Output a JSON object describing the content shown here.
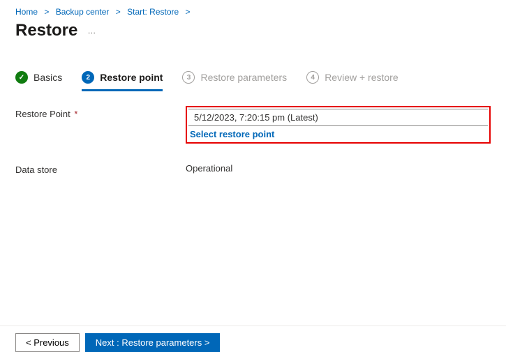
{
  "breadcrumb": {
    "items": [
      "Home",
      "Backup center",
      "Start: Restore"
    ]
  },
  "page": {
    "title": "Restore",
    "more": "…"
  },
  "tabs": {
    "basics": {
      "label": "Basics",
      "icon_check": "✓"
    },
    "restore_point": {
      "label": "Restore point",
      "num": "2"
    },
    "restore_params": {
      "label": "Restore parameters",
      "num": "3"
    },
    "review": {
      "label": "Review + restore",
      "num": "4"
    }
  },
  "form": {
    "restore_point": {
      "label": "Restore Point",
      "required_marker": "*",
      "value": "5/12/2023, 7:20:15 pm (Latest)",
      "link": "Select restore point"
    },
    "data_store": {
      "label": "Data store",
      "value": "Operational"
    }
  },
  "footer": {
    "previous": "<  Previous",
    "next": "Next : Restore parameters  >"
  }
}
